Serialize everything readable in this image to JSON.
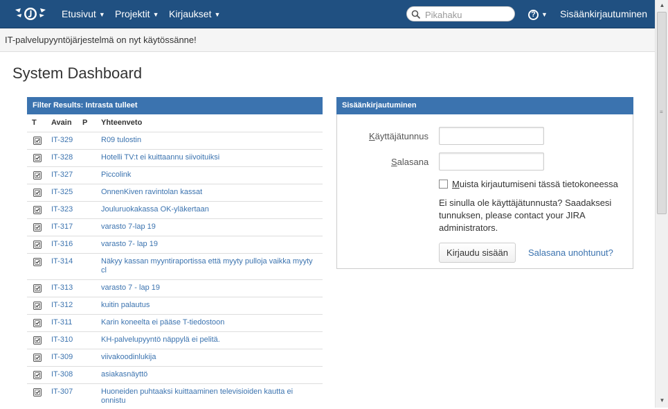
{
  "topbar": {
    "nav": [
      {
        "label": "Etusivut"
      },
      {
        "label": "Projektit"
      },
      {
        "label": "Kirjaukset"
      }
    ],
    "search_placeholder": "Pikahaku",
    "login_label": "Sisäänkirjautuminen",
    "help_glyph": "?"
  },
  "announcement": "IT-palvelupyyntöjärjestelmä on nyt käytössänne!",
  "page_title": "System Dashboard",
  "filter_gadget": {
    "title": "Filter Results: Intrasta tulleet",
    "columns": [
      "T",
      "Avain",
      "P",
      "Yhteenveto"
    ],
    "rows": [
      {
        "key": "IT-329",
        "summary": "R09 tulostin"
      },
      {
        "key": "IT-328",
        "summary": "Hotelli TV:t ei kuittaannu siivoituiksi"
      },
      {
        "key": "IT-327",
        "summary": "Piccolink"
      },
      {
        "key": "IT-325",
        "summary": "OnnenKiven ravintolan kassat"
      },
      {
        "key": "IT-323",
        "summary": "Jouluruokakassa OK-yläkertaan"
      },
      {
        "key": "IT-317",
        "summary": "varasto 7-lap 19"
      },
      {
        "key": "IT-316",
        "summary": "varasto 7- lap 19"
      },
      {
        "key": "IT-314",
        "summary": "Näkyy kassan myyntiraportissa että myyty pulloja vaikka myyty cl"
      },
      {
        "key": "IT-313",
        "summary": "varasto 7 - lap 19"
      },
      {
        "key": "IT-312",
        "summary": "kuitin palautus"
      },
      {
        "key": "IT-311",
        "summary": "Karin koneelta ei pääse T-tiedostoon"
      },
      {
        "key": "IT-310",
        "summary": "KH-palvelupyyntö näppylä ei pelitä."
      },
      {
        "key": "IT-309",
        "summary": "viivakoodinlukija"
      },
      {
        "key": "IT-308",
        "summary": "asiakasnäyttö"
      },
      {
        "key": "IT-307",
        "summary": "Huoneiden puhtaaksi kuittaaminen televisioiden kautta ei onnistu"
      }
    ]
  },
  "login_gadget": {
    "title": "Sisäänkirjautuminen",
    "username_label_first": "K",
    "username_label_rest": "äyttäjätunnus",
    "password_label_first": "S",
    "password_label_rest": "alasana",
    "username_value": "",
    "password_value": "",
    "remember_first": "M",
    "remember_rest": "uista kirjautumiseni tässä tietokoneessa",
    "remember_checked": false,
    "signup_text": "Ei sinulla ole käyttäjätunnusta? Saadaksesi tunnuksen, please contact your JIRA administrators.",
    "login_button": "Kirjaudu sisään",
    "forgot_link": "Salasana unohtunut?"
  },
  "colors": {
    "header_bg": "#205081",
    "gadget_header": "#3b73af",
    "link": "#3b73af"
  }
}
